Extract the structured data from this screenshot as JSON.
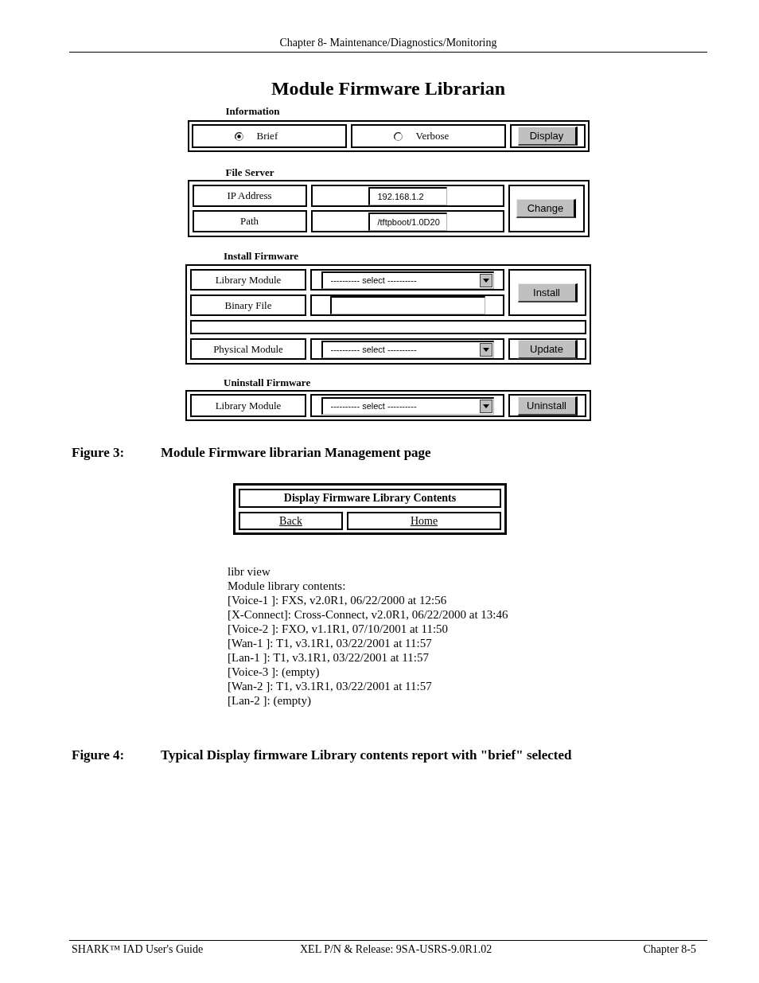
{
  "header": {
    "chapter": "Chapter 8- Maintenance/Diagnostics/Monitoring"
  },
  "title": "Module Firmware Librarian",
  "information": {
    "label": "Information",
    "options": [
      {
        "label": "Brief",
        "selected": true
      },
      {
        "label": "Verbose",
        "selected": false
      }
    ],
    "button": "Display"
  },
  "file_server": {
    "label": "File Server",
    "fields": [
      {
        "kind": "input",
        "label": "IP Address",
        "value": "192.168.1.2"
      },
      {
        "kind": "input",
        "label": "Path",
        "value": "/tftpboot/1.0D20"
      }
    ],
    "button": "Change"
  },
  "install_firmware": {
    "label": "Install Firmware",
    "rows": [
      {
        "kind": "select",
        "label": "Library Module",
        "value": "---------- select ----------"
      },
      {
        "kind": "input",
        "label": "Binary File"
      }
    ],
    "button": "Install",
    "update_row": {
      "kind": "select",
      "label": "Physical Module",
      "value": "---------- select ----------",
      "button": "Update"
    }
  },
  "uninstall_firmware": {
    "label": "Uninstall Firmware",
    "field": {
      "kind": "select",
      "label": "Library Module",
      "value": "---------- select ----------"
    },
    "button": "Uninstall"
  },
  "figure_3": {
    "number": "Figure 3:",
    "caption": "Module Firmware librarian Management page"
  },
  "library_panel": {
    "title": "Display Firmware Library Contents",
    "links": [
      "Back",
      "Home"
    ]
  },
  "report_lines": [
    "libr view",
    "Module library contents:",
    "[Voice-1 ]: FXS, v2.0R1, 06/22/2000 at 12:56",
    "[X-Connect]: Cross-Connect, v2.0R1, 06/22/2000 at 13:46",
    "[Voice-2 ]: FXO, v1.1R1, 07/10/2001 at 11:50",
    "[Wan-1 ]: T1, v3.1R1, 03/22/2001 at 11:57",
    "[Lan-1 ]: T1, v3.1R1, 03/22/2001 at 11:57",
    "[Voice-3 ]: (empty)",
    "[Wan-2 ]: T1, v3.1R1, 03/22/2001 at 11:57",
    "[Lan-2 ]: (empty)"
  ],
  "figure_4": {
    "number": "Figure 4:",
    "caption": "Typical Display firmware Library contents report with \"brief\" selected"
  },
  "footer": {
    "left": "SHARK™ IAD User's Guide",
    "center": "XEL P/N & Release: 9SA-USRS-9.0R1.02",
    "right": "Chapter 8-5"
  }
}
